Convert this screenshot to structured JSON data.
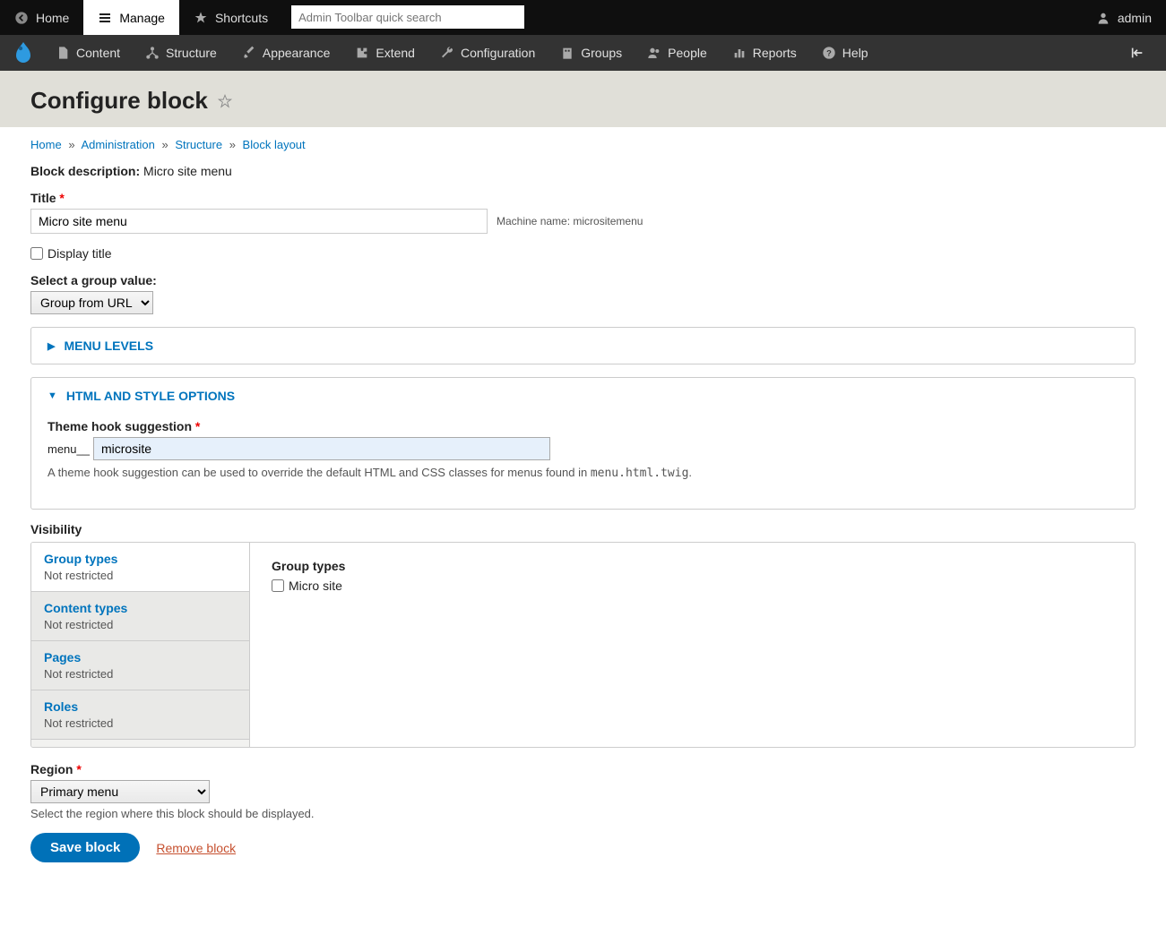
{
  "toolbar": {
    "home": "Home",
    "manage": "Manage",
    "shortcuts": "Shortcuts",
    "search_placeholder": "Admin Toolbar quick search",
    "user": "admin"
  },
  "admin_menu": {
    "items": [
      "Content",
      "Structure",
      "Appearance",
      "Extend",
      "Configuration",
      "Groups",
      "People",
      "Reports",
      "Help"
    ]
  },
  "page": {
    "title": "Configure block"
  },
  "breadcrumb": {
    "items": [
      "Home",
      "Administration",
      "Structure",
      "Block layout"
    ]
  },
  "block": {
    "desc_label": "Block description:",
    "desc_value": "Micro site menu",
    "title_label": "Title",
    "title_value": "Micro site menu",
    "machine_label": "Machine name:",
    "machine_value": "micrositemenu",
    "display_title_label": "Display title",
    "group_label": "Select a group value:",
    "group_value": "Group from URL"
  },
  "details": {
    "menu_levels": "MENU LEVELS",
    "html_style": "HTML AND STYLE OPTIONS",
    "theme_hook_label": "Theme hook suggestion",
    "theme_hook_prefix": "menu__",
    "theme_hook_value": "microsite",
    "theme_hook_help": "A theme hook suggestion can be used to override the default HTML and CSS classes for menus found in ",
    "theme_hook_help_code": "menu.html.twig",
    "theme_hook_help_end": "."
  },
  "visibility": {
    "label": "Visibility",
    "tabs": [
      {
        "title": "Group types",
        "summary": "Not restricted"
      },
      {
        "title": "Content types",
        "summary": "Not restricted"
      },
      {
        "title": "Pages",
        "summary": "Not restricted"
      },
      {
        "title": "Roles",
        "summary": "Not restricted"
      }
    ],
    "panel_title": "Group types",
    "panel_option": "Micro site"
  },
  "region": {
    "label": "Region",
    "value": "Primary menu",
    "help": "Select the region where this block should be displayed."
  },
  "actions": {
    "save": "Save block",
    "remove": "Remove block"
  }
}
